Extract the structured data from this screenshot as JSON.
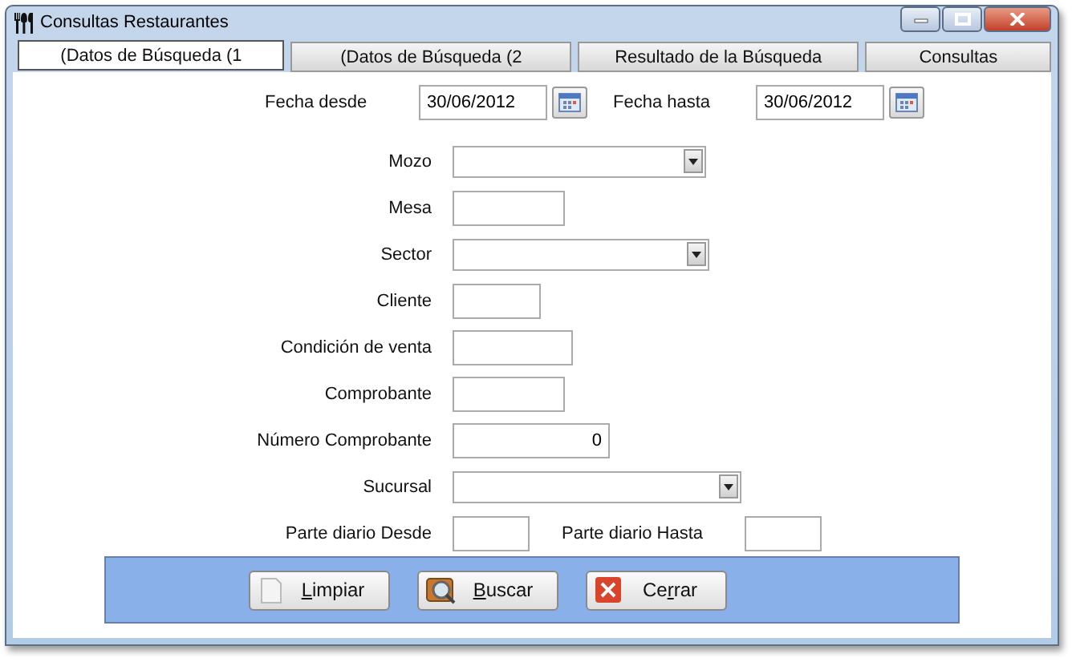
{
  "window": {
    "title": "Consultas Restaurantes"
  },
  "tabs": [
    {
      "label": "(Datos de Búsqueda (1",
      "selected": true
    },
    {
      "label": "(Datos de Búsqueda (2",
      "selected": false
    },
    {
      "label": "Resultado de la Búsqueda",
      "selected": false
    },
    {
      "label": "Consultas",
      "selected": false
    }
  ],
  "dates": [
    {
      "label": "Fecha desde",
      "value": "30/06/2012"
    },
    {
      "label": "Fecha hasta",
      "value": "30/06/2012"
    }
  ],
  "fields": [
    {
      "kind": "dropdown",
      "label": "Mozo"
    },
    {
      "kind": "text",
      "label": "Mesa"
    },
    {
      "kind": "dropdown",
      "label": "Sector"
    },
    {
      "kind": "text",
      "label": "Cliente"
    },
    {
      "kind": "text",
      "label": "Condición de venta"
    },
    {
      "kind": "text",
      "label": "Comprobante"
    },
    {
      "kind": "number",
      "label": "Número Comprobante",
      "value": "0"
    },
    {
      "kind": "dropdown",
      "label": "Sucursal"
    },
    {
      "kind": "range",
      "label": "Parte diario Desde",
      "label_2": "Parte diario Hasta"
    }
  ],
  "buttons": [
    {
      "kind": "clear",
      "parts": [
        {
          "text": "L",
          "underlined": true
        },
        {
          "text": "impiar",
          "underlined": false
        }
      ]
    },
    {
      "kind": "search",
      "parts": [
        {
          "text": "B",
          "underlined": true
        },
        {
          "text": "uscar",
          "underlined": false
        }
      ]
    },
    {
      "kind": "close",
      "parts": [
        {
          "text": "Ce",
          "underlined": false
        },
        {
          "text": "r",
          "underlined": true
        },
        {
          "text": "rar",
          "underlined": false
        }
      ]
    }
  ]
}
